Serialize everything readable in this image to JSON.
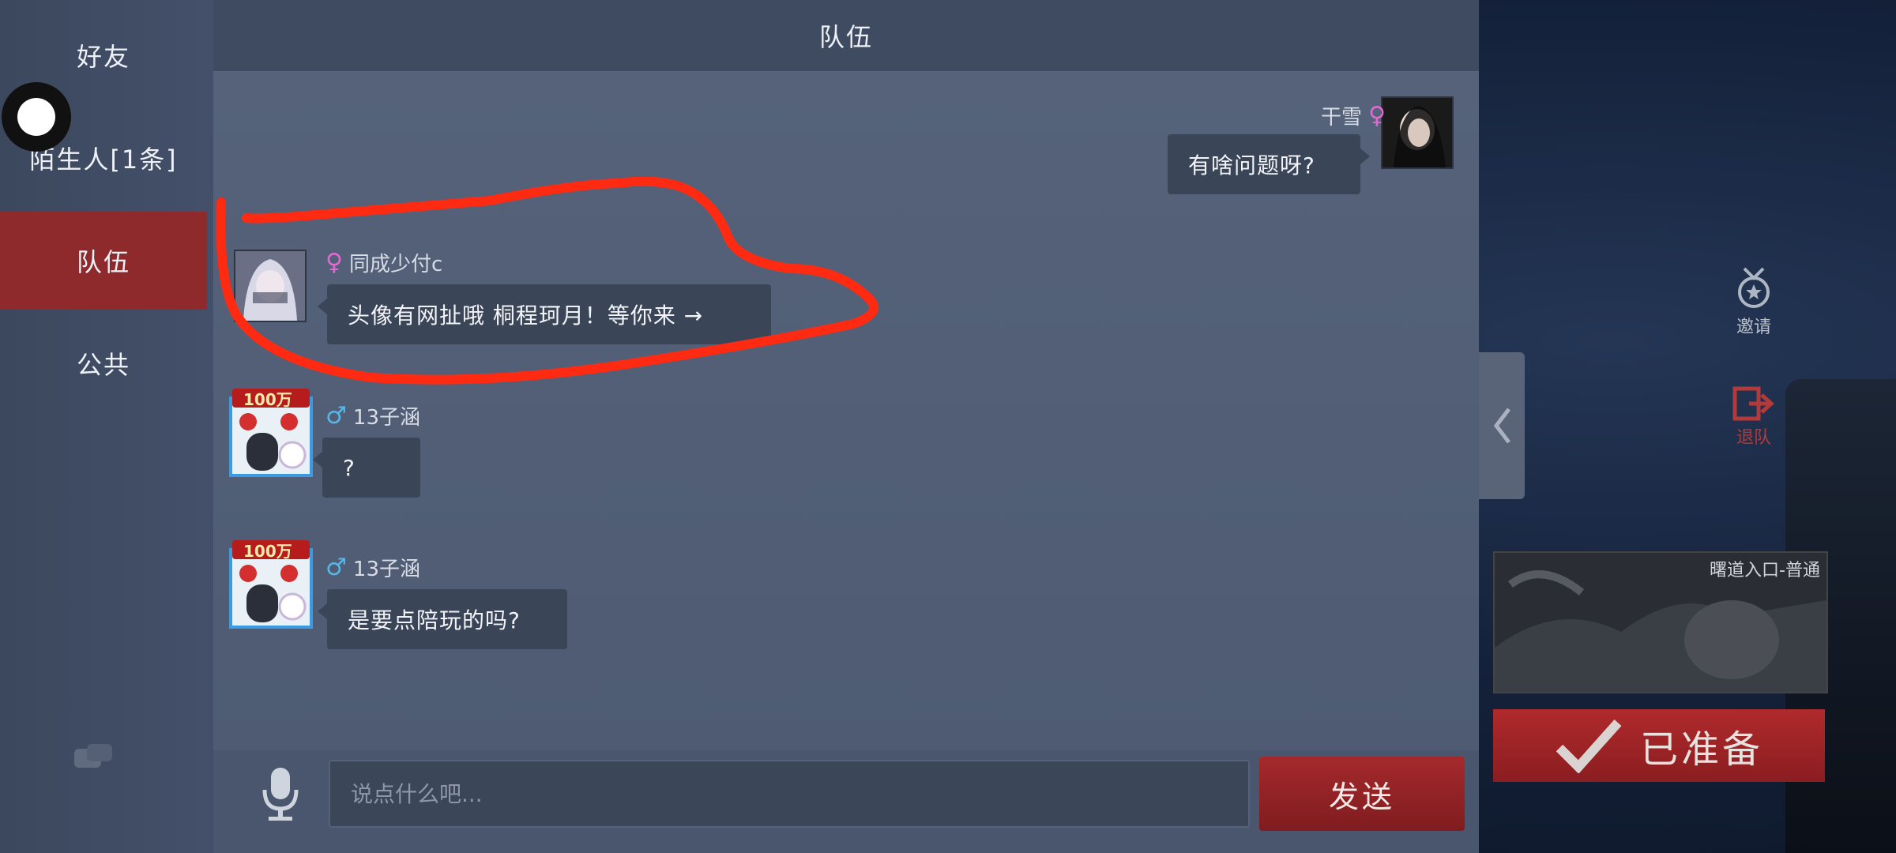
{
  "nav": {
    "items": [
      {
        "label": "好友"
      },
      {
        "label": "陌生人[1条]"
      },
      {
        "label": "队伍"
      },
      {
        "label": "公共"
      }
    ],
    "active_index": 2
  },
  "header": {
    "title": "队伍"
  },
  "messages": [
    {
      "side": "right",
      "name": "干雪",
      "gender": "female",
      "text": "有啥问题呀?"
    },
    {
      "side": "left",
      "name": "同成少付c",
      "gender": "female",
      "text": "头像有网扯哦 桐程珂月！等你来 →"
    },
    {
      "side": "left",
      "name": "13子涵",
      "gender": "male",
      "badge": "100万",
      "text": "?"
    },
    {
      "side": "left",
      "name": "13子涵",
      "gender": "male",
      "badge": "100万",
      "text": "是要点陪玩的吗?"
    }
  ],
  "input": {
    "placeholder": "说点什么吧...",
    "send_label": "发送"
  },
  "side": {
    "invite_label": "邀请",
    "leave_label": "退队",
    "map_card_title": "曙道入口-普通",
    "ready_label": "已准备"
  },
  "colors": {
    "accent_red": "#8e2a2c",
    "annotation_red": "#ff2a12",
    "female": "#e06ad2",
    "male": "#56b7e8"
  }
}
